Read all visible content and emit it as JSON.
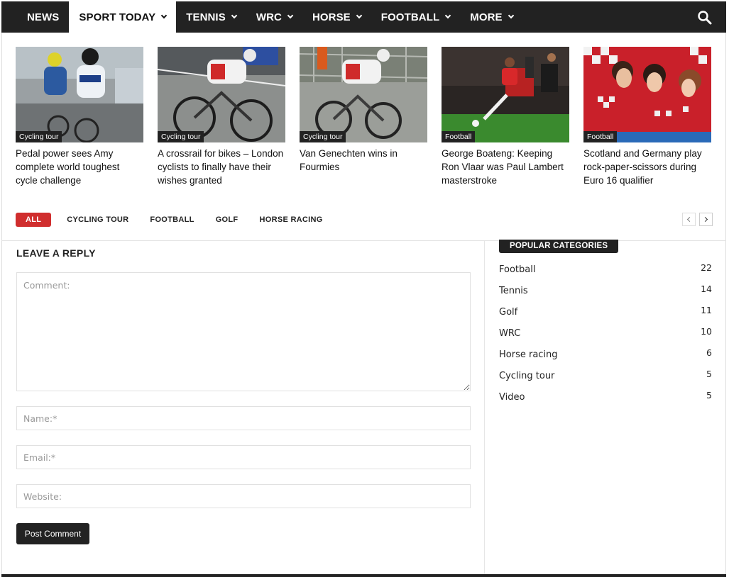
{
  "nav": {
    "items": [
      {
        "label": "NEWS"
      },
      {
        "label": "SPORT TODAY"
      },
      {
        "label": "TENNIS"
      },
      {
        "label": "WRC"
      },
      {
        "label": "HORSE"
      },
      {
        "label": "FOOTBALL"
      },
      {
        "label": "MORE"
      }
    ],
    "active": "SPORT TODAY",
    "search_icon": "search-icon"
  },
  "articles": [
    {
      "category": "Cycling tour",
      "title": "Pedal power sees Amy complete world toughest cycle challenge"
    },
    {
      "category": "Cycling tour",
      "title": "A crossrail for bikes – London cyclists to finally have their wishes granted"
    },
    {
      "category": "Cycling tour",
      "title": "Van Genechten wins in Fourmies"
    },
    {
      "category": "Football",
      "title": "George Boateng: Keeping Ron Vlaar was Paul Lambert masterstroke"
    },
    {
      "category": "Football",
      "title": "Scotland and Germany play rock-paper-scissors during Euro 16 qualifier"
    }
  ],
  "filters": [
    "ALL",
    "CYCLING TOUR",
    "FOOTBALL",
    "GOLF",
    "HORSE RACING"
  ],
  "active_filter": "ALL",
  "reply": {
    "title": "LEAVE A REPLY",
    "comment_placeholder": "Comment:",
    "name_placeholder": "Name:*",
    "email_placeholder": "Email:*",
    "website_placeholder": "Website:",
    "submit_label": "Post Comment"
  },
  "sidebar": {
    "heading": "POPULAR CATEGORIES",
    "categories": [
      {
        "name": "Football",
        "count": "22"
      },
      {
        "name": "Tennis",
        "count": "14"
      },
      {
        "name": "Golf",
        "count": "11"
      },
      {
        "name": "WRC",
        "count": "10"
      },
      {
        "name": "Horse racing",
        "count": "6"
      },
      {
        "name": "Cycling tour",
        "count": "5"
      },
      {
        "name": "Video",
        "count": "5"
      }
    ]
  },
  "colors": {
    "nav_bg": "#222222",
    "accent": "#d02e2e",
    "badge_bg": "#222222"
  }
}
